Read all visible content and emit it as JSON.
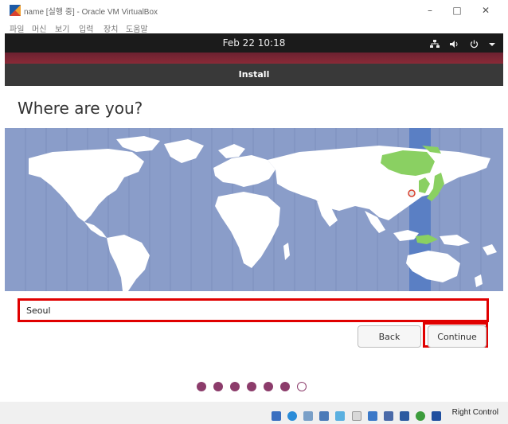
{
  "window": {
    "title": "name [실행 중] - Oracle VM VirtualBox",
    "controls": {
      "minimize": "–",
      "maximize": "□",
      "close": "✕"
    }
  },
  "menu": {
    "items": [
      "파일",
      "머신",
      "보기",
      "입력",
      "장치",
      "도움말"
    ]
  },
  "guest": {
    "topbar": {
      "clock": "Feb 22  10:18",
      "tray_icons": [
        "network-icon",
        "volume-icon",
        "power-icon",
        "dropdown-icon"
      ]
    },
    "header": {
      "title": "Install"
    },
    "page": {
      "title": "Where are you?",
      "location_value": "Seoul",
      "selected_timezone_highlight": "#5a7fc4"
    },
    "buttons": {
      "back": "Back",
      "continue": "Continue"
    },
    "progress": {
      "total": 7,
      "filled": 6,
      "color": "#8c3c6b"
    }
  },
  "statusbar": {
    "host_key": "Right Control"
  },
  "colors": {
    "map_ocean": "#8a9dc9",
    "map_land": "#ffffff",
    "highlight_country": "#8ad062",
    "annotation_red": "#e00000"
  }
}
